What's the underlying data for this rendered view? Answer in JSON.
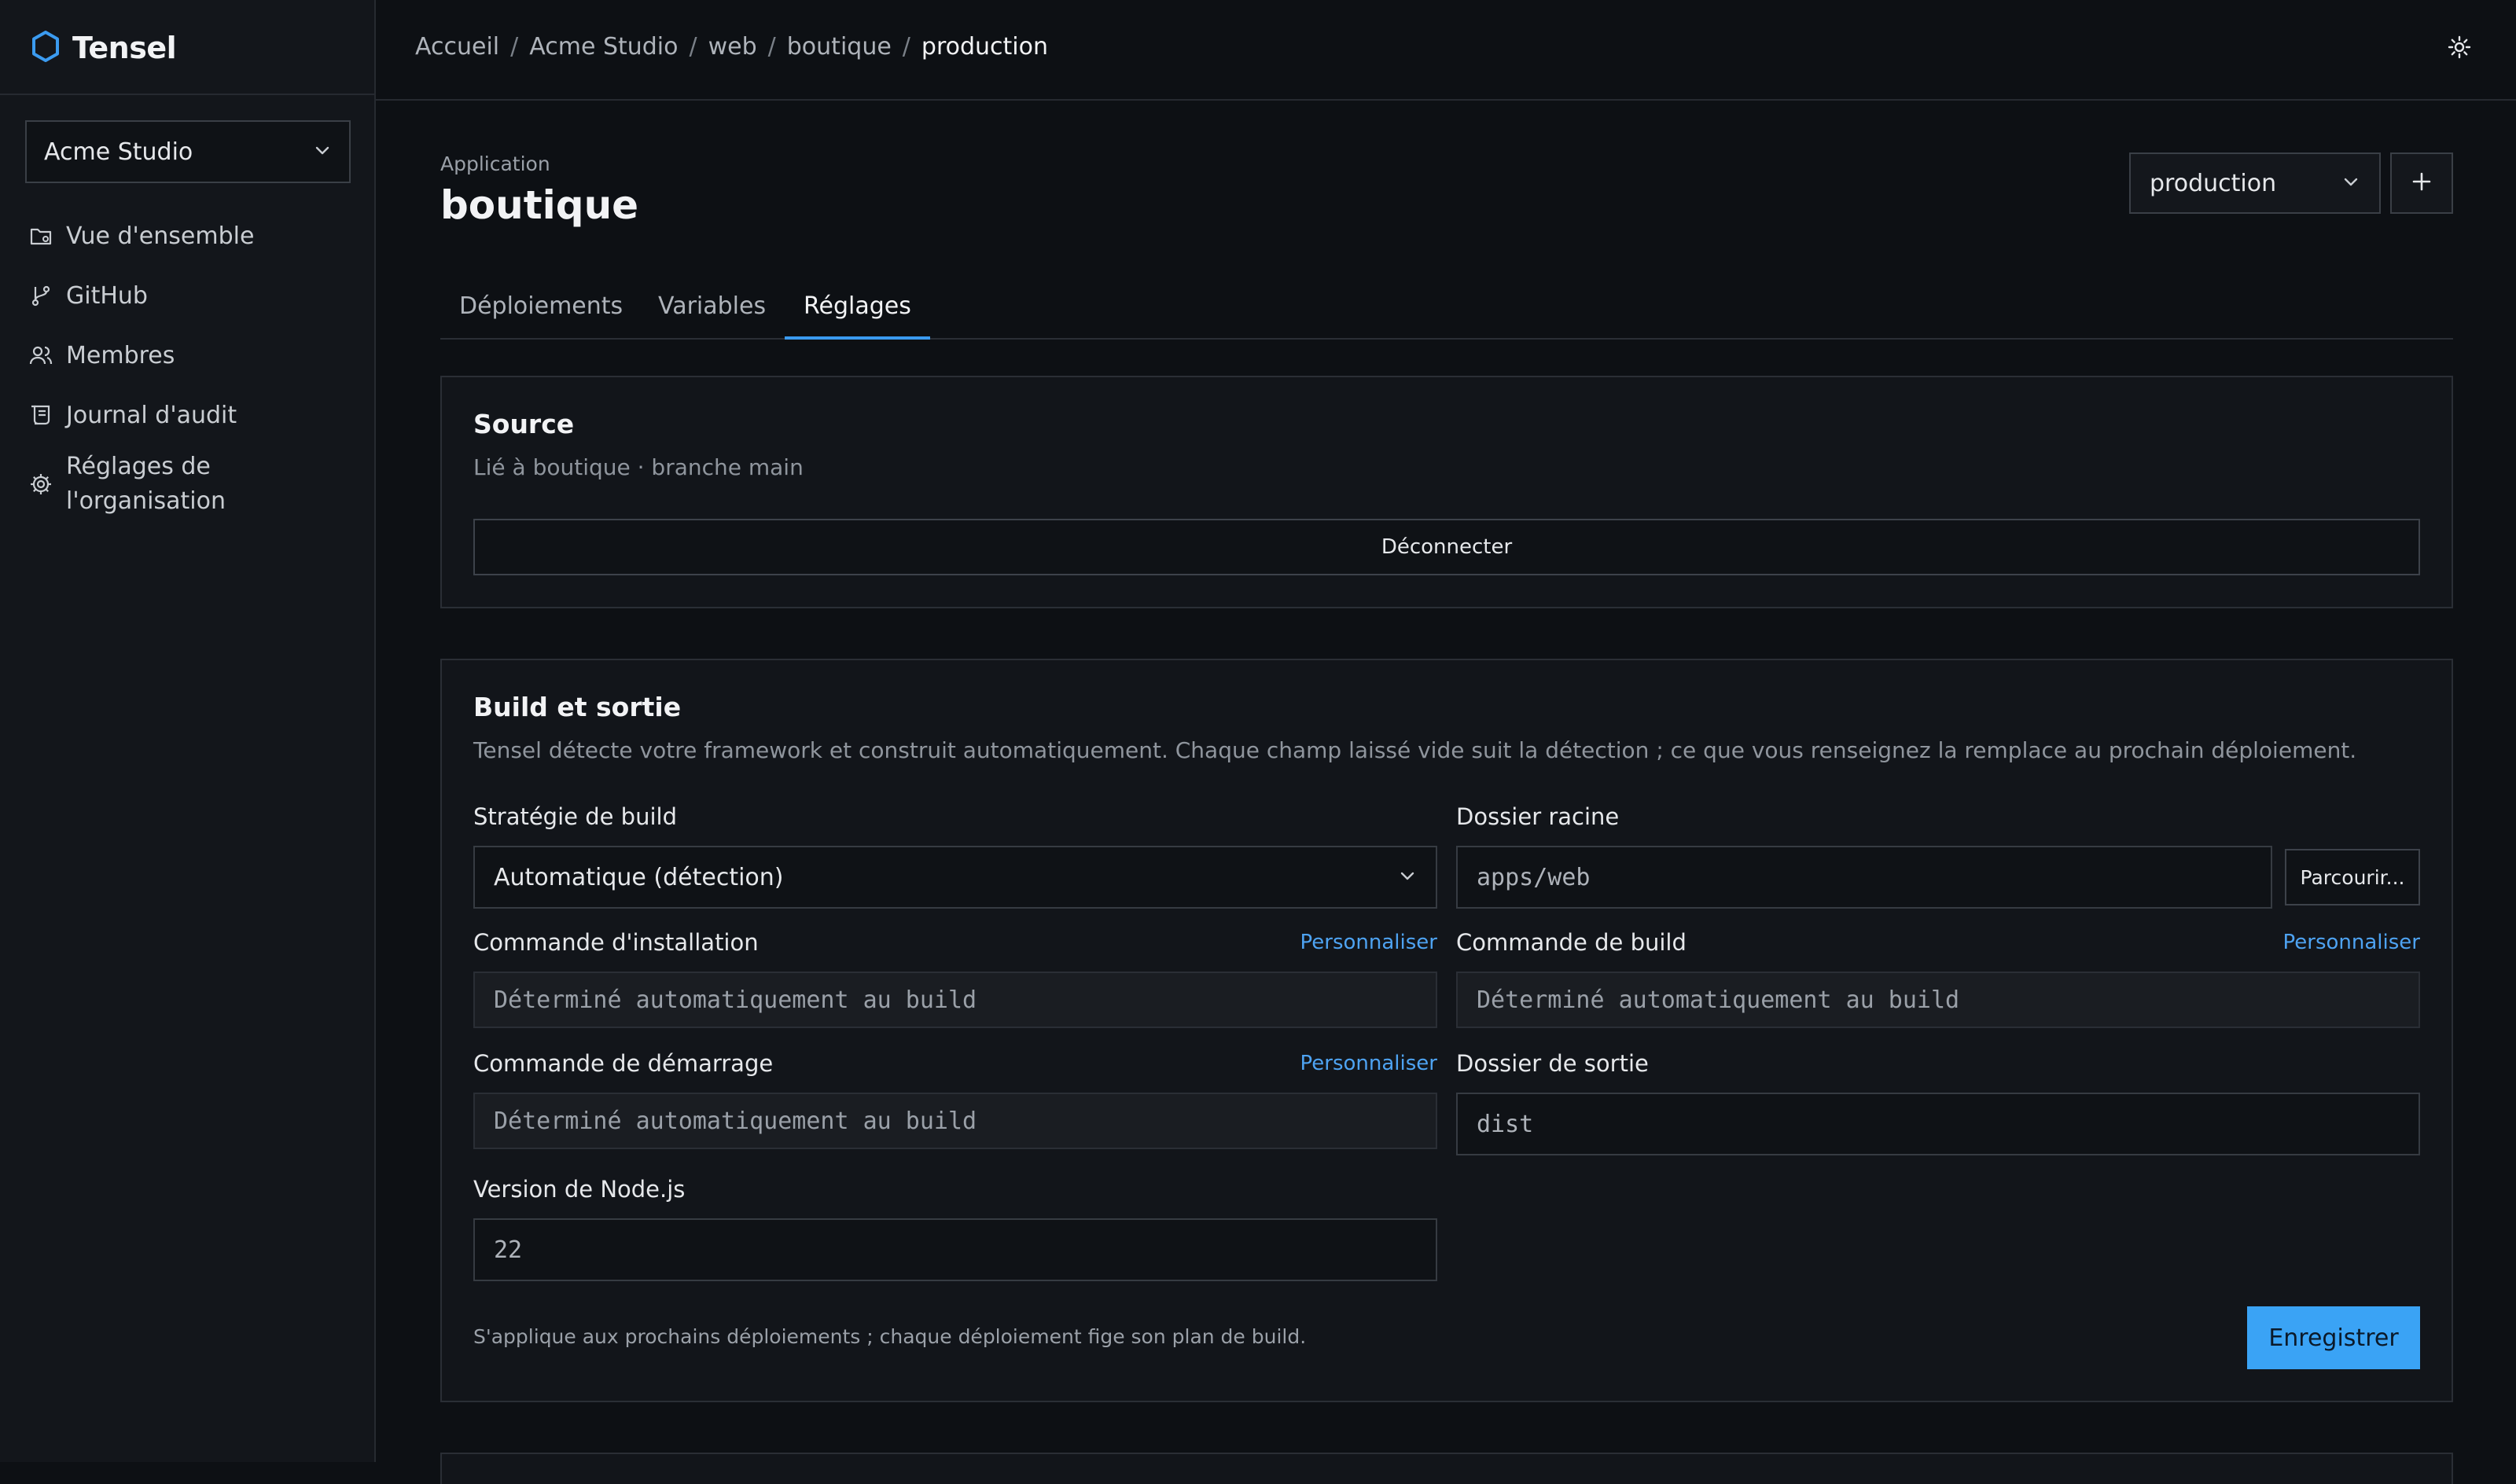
{
  "brand": {
    "name": "Tensel",
    "icon": "hexagon-logo-icon"
  },
  "org_selector": {
    "value": "Acme Studio",
    "icon": "chevron-down-icon"
  },
  "sidebar": {
    "items": [
      {
        "label": "Vue d'ensemble",
        "icon": "folder-icon"
      },
      {
        "label": "GitHub",
        "icon": "git-branch-icon"
      },
      {
        "label": "Membres",
        "icon": "users-icon"
      },
      {
        "label": "Journal d'audit",
        "icon": "scroll-icon"
      },
      {
        "label_line1": "Réglages de",
        "label_line2": "l'organisation",
        "icon": "gear-icon"
      }
    ]
  },
  "breadcrumb": {
    "items": [
      "Accueil",
      "Acme Studio",
      "web",
      "boutique"
    ],
    "current": "production",
    "separator": "/"
  },
  "theme_toggle": {
    "icon": "sun-icon"
  },
  "header": {
    "label": "Application",
    "title": "boutique",
    "env_selector": "production",
    "add_icon": "plus-icon"
  },
  "tabs": [
    {
      "label": "Déploiements",
      "active": false
    },
    {
      "label": "Variables",
      "active": false
    },
    {
      "label": "Réglages",
      "active": true
    }
  ],
  "source": {
    "title": "Source",
    "description": "Lié à boutique · branche main",
    "disconnect_label": "Déconnecter"
  },
  "build": {
    "title": "Build et sortie",
    "description": "Tensel détecte votre framework et construit automatiquement. Chaque champ laissé vide suit la détection ; ce que vous renseignez la remplace au prochain déploiement.",
    "strategy": {
      "label": "Stratégie de build",
      "value": "Automatique (détection)"
    },
    "root_dir": {
      "label": "Dossier racine",
      "value": "apps/web",
      "browse_label": "Parcourir..."
    },
    "install_cmd": {
      "label": "Commande d'installation",
      "customize": "Personnaliser",
      "placeholder": "Déterminé automatiquement au build"
    },
    "build_cmd": {
      "label": "Commande de build",
      "customize": "Personnaliser",
      "placeholder": "Déterminé automatiquement au build"
    },
    "start_cmd": {
      "label": "Commande de démarrage",
      "customize": "Personnaliser",
      "placeholder": "Déterminé automatiquement au build"
    },
    "output_dir": {
      "label": "Dossier de sortie",
      "value": "dist"
    },
    "node_version": {
      "label": "Version de Node.js",
      "value": "22"
    },
    "footnote": "S'applique aux prochains déploiements ; chaque déploiement fige son plan de build.",
    "save_label": "Enregistrer"
  },
  "colors": {
    "accent": "#3aa3f5",
    "link": "#4ea3f2",
    "background": "#0d1014",
    "sidebar": "#13161b"
  }
}
